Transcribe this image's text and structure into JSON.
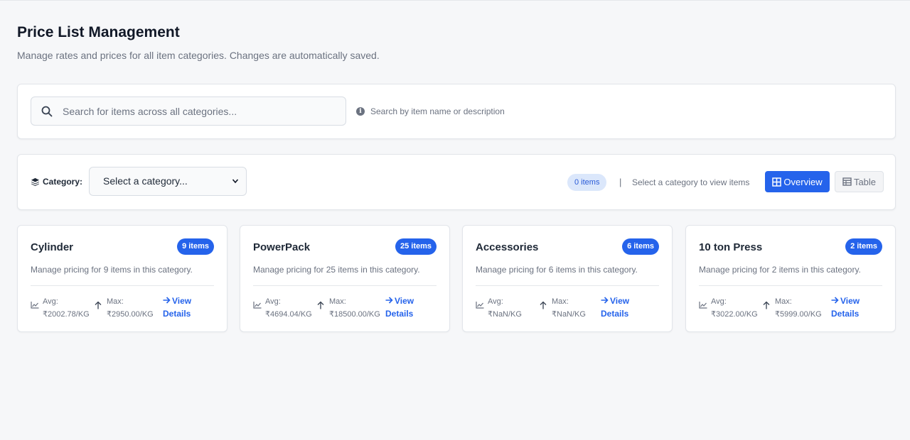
{
  "header": {
    "title": "Price List Management",
    "subtitle": "Manage rates and prices for all item categories. Changes are automatically saved."
  },
  "search": {
    "placeholder": "Search for items across all categories...",
    "hint": "Search by item name or description"
  },
  "category_bar": {
    "label": "Category:",
    "select_value": "Select a category...",
    "items_count": "0 items",
    "separator": "|",
    "hint": "Select a category to view items",
    "overview_label": "Overview",
    "table_label": "Table"
  },
  "colors": {
    "accent": "#2563eb",
    "background": "#f6f7f9",
    "muted_text": "#6b7280"
  },
  "cards": [
    {
      "name": "Cylinder",
      "badge": "9 items",
      "description": "Manage pricing for 9 items in this category.",
      "avg_label": "Avg:",
      "avg_value": "₹2002.78/KG",
      "max_label": "Max:",
      "max_value": "₹2950.00/KG",
      "view_label_1": "View",
      "view_label_2": "Details"
    },
    {
      "name": "PowerPack",
      "badge": "25 items",
      "description": "Manage pricing for 25 items in this category.",
      "avg_label": "Avg:",
      "avg_value": "₹4694.04/KG",
      "max_label": "Max:",
      "max_value": "₹18500.00/KG",
      "view_label_1": "View",
      "view_label_2": "Details"
    },
    {
      "name": "Accessories",
      "badge": "6 items",
      "description": "Manage pricing for 6 items in this category.",
      "avg_label": "Avg:",
      "avg_value": "₹NaN/KG",
      "max_label": "Max:",
      "max_value": "₹NaN/KG",
      "view_label_1": "View",
      "view_label_2": "Details"
    },
    {
      "name": "10 ton Press",
      "badge": "2 items",
      "description": "Manage pricing for 2 items in this category.",
      "avg_label": "Avg:",
      "avg_value": "₹3022.00/KG",
      "max_label": "Max:",
      "max_value": "₹5999.00/KG",
      "view_label_1": "View",
      "view_label_2": "Details"
    }
  ]
}
